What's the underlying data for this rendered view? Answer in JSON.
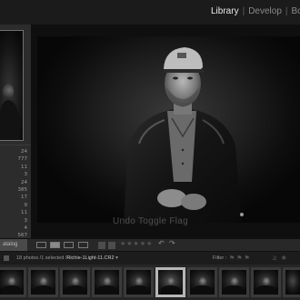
{
  "modules": {
    "items": [
      {
        "label": "Library",
        "active": true
      },
      {
        "label": "Develop",
        "active": false
      },
      {
        "label": "Book",
        "active": false
      }
    ],
    "separator": "|"
  },
  "left_panel": {
    "counts": [
      "24",
      "777",
      "11",
      "3",
      "24",
      "385",
      "17",
      "9",
      "11",
      "3",
      "4",
      "567",
      "47",
      "24",
      "4",
      "18"
    ],
    "selected_index": 15
  },
  "toolbar": {
    "catalog_label": "atalog",
    "stars": "★★★★★",
    "rotate_left": "↶",
    "rotate_right": "↷"
  },
  "overlay": {
    "text": "Undo Toggle Flag"
  },
  "filmstrip_header": {
    "info": "18 photos /1 selected /",
    "filename": "Richie-1Light-11.CR2",
    "dropdown": "▾",
    "filter_label": "Filter :",
    "filter_flags": "⚑⚑⚑",
    "filter_stars": "≥ ★"
  },
  "filmstrip": {
    "thumbnail_count": 10,
    "selected_index": 5
  },
  "colors": {
    "active_module": "#eaeaea",
    "inactive_module": "#8a8a8a",
    "panel_bg": "#2c2c2c",
    "center_bg": "#0f0f0f",
    "selected_thumb": "#b6b6b6"
  }
}
